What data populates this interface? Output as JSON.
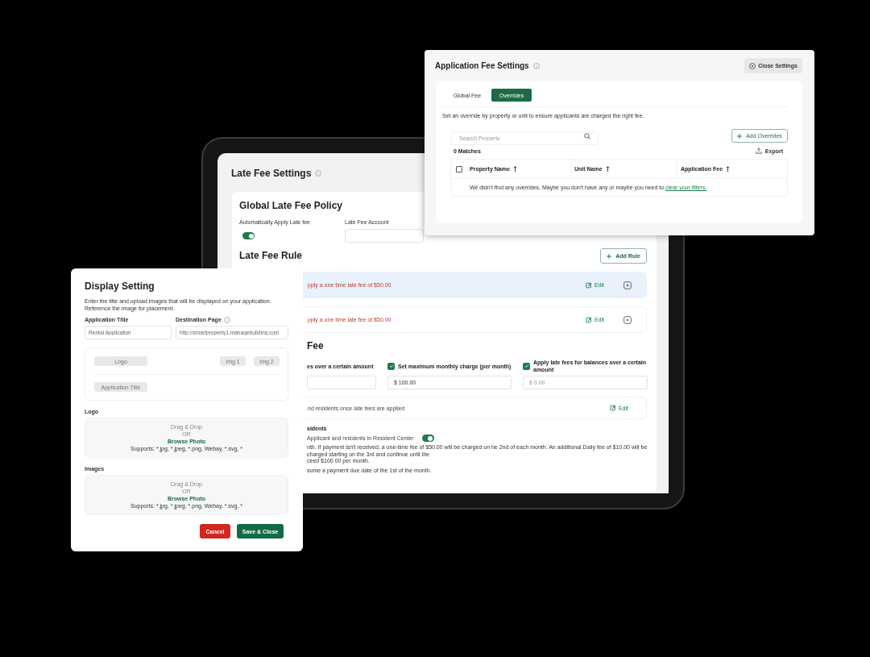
{
  "late_fee_settings": {
    "title": "Late Fee Settings",
    "global_policy": {
      "heading": "Global Late Fee Policy",
      "auto_apply": {
        "label": "Automatically Apply Late fee",
        "on": true
      },
      "account": {
        "label": "Late Fee Account"
      }
    },
    "rule_section": {
      "heading": "Late Fee Rule",
      "add_button": "Add Rule"
    },
    "rules": [
      {
        "text": "pply a one time late fee of $50.00",
        "action": "Edit",
        "selected": true
      },
      {
        "text": "pply a one time late fee of $50.00",
        "action": "Edit",
        "selected": false
      }
    ],
    "fee_section": {
      "heading": "Fee",
      "limit_label": "es over a certain amount",
      "options": [
        {
          "label": "Set maximum monthly charge (per month)",
          "checked": true,
          "value": "$ 100.00"
        },
        {
          "label": "Apply late fees for balances over a certain amount",
          "checked": true,
          "placeholder": "$ 0.00"
        }
      ],
      "notice": {
        "text": "nd residents once late fees are applied",
        "action": "Edit"
      }
    },
    "residents_section": {
      "heading": "sidents",
      "notify": {
        "label": "Applicant and residents in Resident Center",
        "on": true
      },
      "summary_lines": [
        "nth. If payment isn't received, a one-time fee of $50.00 will be charged on he 2nd of each month. An additional Daily fee of $10.00 will be charged starting on the 3rd and continue until the",
        "ceed $100.00 per month."
      ],
      "note": "sume a payment due date of the 1st of the month."
    }
  },
  "display_setting": {
    "title": "Display Setting",
    "description": "Enter the title and upload images that will be displayed on your application. Reference the image for placement.",
    "fields": [
      {
        "label": "Application Title",
        "value": "Rental Application",
        "info": false
      },
      {
        "label": "Destination Page",
        "value": "http://smartproperty1.managebuilding.com",
        "info": true
      }
    ],
    "preview": {
      "logo": "Logo",
      "images": [
        "Img 1",
        "Img 2"
      ],
      "title": "Application Title"
    },
    "uploads": [
      {
        "label": "Logo",
        "drag": "Drag & Drop",
        "or": "OR",
        "browse": "Browse Photo",
        "formats": "Supports: *.jpg, *.jpeg, *.png, Webay, *.svg, *"
      },
      {
        "label": "Images",
        "drag": "Drag & Drop",
        "or": "OR",
        "browse": "Browse Photo",
        "formats": "Supports: *.jpg, *.jpeg, *.png, Webay, *.svg, *"
      }
    ],
    "cancel_button": "Cancel",
    "save_button": "Save & Close"
  },
  "application_fee_settings": {
    "title": "Application Fee Settings",
    "close_button": "Close Settings",
    "tabs": [
      {
        "label": "Global Fee",
        "selected": false
      },
      {
        "label": "Overrides",
        "selected": true
      }
    ],
    "description": "Set an override by property or unit to ensure applicants are charged the right fee.",
    "search": {
      "placeholder": "Search Property"
    },
    "add_button": "Add Overrides",
    "matches": "0 Matches",
    "export_button": "Export",
    "table": {
      "select_all": {
        "checked": false
      },
      "columns": [
        "Property Name",
        "Unit Name",
        "Application Fee"
      ],
      "empty_text": "We didn't find any overrides. Maybe you don't have any or maybe you need to",
      "empty_link": "clear your filters."
    }
  }
}
